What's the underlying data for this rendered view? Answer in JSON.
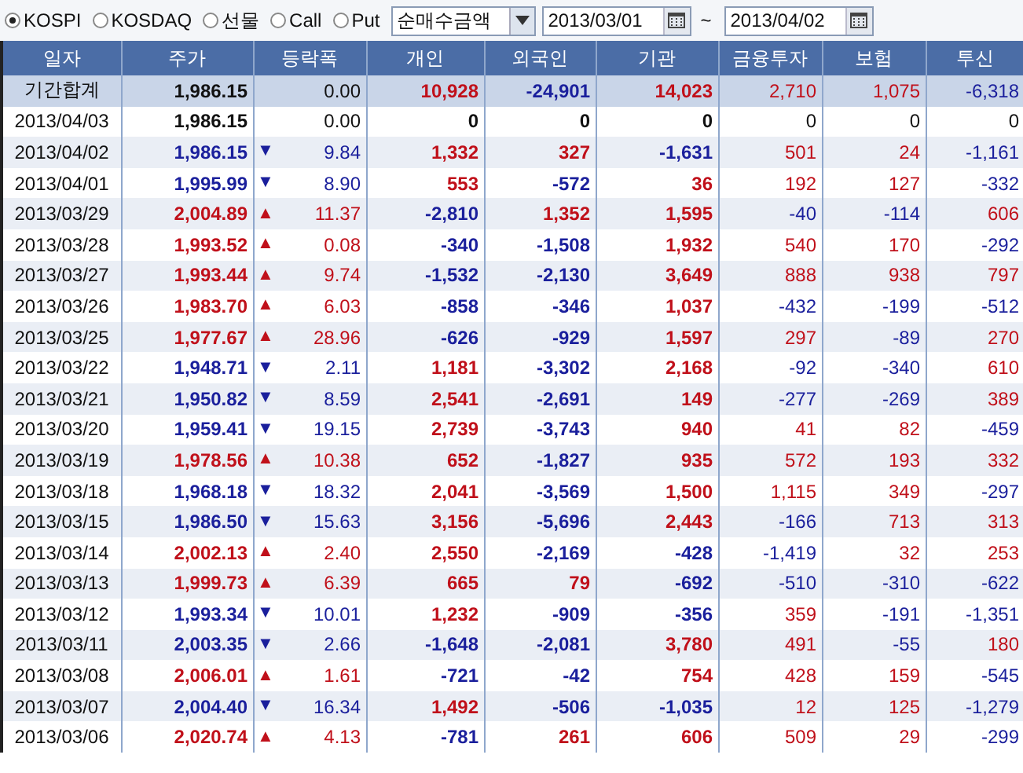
{
  "toolbar": {
    "markets": [
      {
        "label": "KOSPI",
        "selected": true
      },
      {
        "label": "KOSDAQ",
        "selected": false
      },
      {
        "label": "선물",
        "selected": false
      },
      {
        "label": "Call",
        "selected": false
      },
      {
        "label": "Put",
        "selected": false
      }
    ],
    "measure": "순매수금액",
    "date_from": "2013/03/01",
    "range_separator": "~",
    "date_to": "2013/04/02"
  },
  "table": {
    "columns": [
      "일자",
      "주가",
      "등락폭",
      "개인",
      "외국인",
      "기관",
      "금융투자",
      "보험",
      "투신"
    ],
    "rows": [
      {
        "kind": "total",
        "color": "#111111",
        "cells": [
          "기간합계",
          "1,986.15",
          "0.00",
          "10,928",
          "-24,901",
          "14,023",
          "2,710",
          "1,075",
          "-6,318"
        ]
      },
      {
        "kind": "day",
        "color": "#111111",
        "cells": [
          "2013/04/03",
          "1,986.15",
          "0.00",
          "0",
          "0",
          "0",
          "0",
          "0",
          "0"
        ]
      },
      {
        "kind": "day",
        "color": "#1a1f9c",
        "arrow": "▼",
        "cells": [
          "2013/04/02",
          "1,986.15",
          "9.84",
          "1,332",
          "327",
          "-1,631",
          "501",
          "24",
          "-1,161"
        ]
      },
      {
        "kind": "day",
        "color": "#1a1f9c",
        "arrow": "▼",
        "cells": [
          "2013/04/01",
          "1,995.99",
          "8.90",
          "553",
          "-572",
          "36",
          "192",
          "127",
          "-332"
        ]
      },
      {
        "kind": "day",
        "color": "#c0101a",
        "arrow": "▲",
        "cells": [
          "2013/03/29",
          "2,004.89",
          "11.37",
          "-2,810",
          "1,352",
          "1,595",
          "-40",
          "-114",
          "606"
        ]
      },
      {
        "kind": "day",
        "color": "#c0101a",
        "arrow": "▲",
        "cells": [
          "2013/03/28",
          "1,993.52",
          "0.08",
          "-340",
          "-1,508",
          "1,932",
          "540",
          "170",
          "-292"
        ]
      },
      {
        "kind": "day",
        "color": "#c0101a",
        "arrow": "▲",
        "cells": [
          "2013/03/27",
          "1,993.44",
          "9.74",
          "-1,532",
          "-2,130",
          "3,649",
          "888",
          "938",
          "797"
        ]
      },
      {
        "kind": "day",
        "color": "#c0101a",
        "arrow": "▲",
        "cells": [
          "2013/03/26",
          "1,983.70",
          "6.03",
          "-858",
          "-346",
          "1,037",
          "-432",
          "-199",
          "-512"
        ]
      },
      {
        "kind": "day",
        "color": "#c0101a",
        "arrow": "▲",
        "cells": [
          "2013/03/25",
          "1,977.67",
          "28.96",
          "-626",
          "-929",
          "1,597",
          "297",
          "-89",
          "270"
        ]
      },
      {
        "kind": "day",
        "color": "#1a1f9c",
        "arrow": "▼",
        "cells": [
          "2013/03/22",
          "1,948.71",
          "2.11",
          "1,181",
          "-3,302",
          "2,168",
          "-92",
          "-340",
          "610"
        ]
      },
      {
        "kind": "day",
        "color": "#1a1f9c",
        "arrow": "▼",
        "cells": [
          "2013/03/21",
          "1,950.82",
          "8.59",
          "2,541",
          "-2,691",
          "149",
          "-277",
          "-269",
          "389"
        ]
      },
      {
        "kind": "day",
        "color": "#1a1f9c",
        "arrow": "▼",
        "cells": [
          "2013/03/20",
          "1,959.41",
          "19.15",
          "2,739",
          "-3,743",
          "940",
          "41",
          "82",
          "-459"
        ]
      },
      {
        "kind": "day",
        "color": "#c0101a",
        "arrow": "▲",
        "cells": [
          "2013/03/19",
          "1,978.56",
          "10.38",
          "652",
          "-1,827",
          "935",
          "572",
          "193",
          "332"
        ]
      },
      {
        "kind": "day",
        "color": "#1a1f9c",
        "arrow": "▼",
        "cells": [
          "2013/03/18",
          "1,968.18",
          "18.32",
          "2,041",
          "-3,569",
          "1,500",
          "1,115",
          "349",
          "-297"
        ]
      },
      {
        "kind": "day",
        "color": "#1a1f9c",
        "arrow": "▼",
        "cells": [
          "2013/03/15",
          "1,986.50",
          "15.63",
          "3,156",
          "-5,696",
          "2,443",
          "-166",
          "713",
          "313"
        ]
      },
      {
        "kind": "day",
        "color": "#c0101a",
        "arrow": "▲",
        "cells": [
          "2013/03/14",
          "2,002.13",
          "2.40",
          "2,550",
          "-2,169",
          "-428",
          "-1,419",
          "32",
          "253"
        ]
      },
      {
        "kind": "day",
        "color": "#c0101a",
        "arrow": "▲",
        "cells": [
          "2013/03/13",
          "1,999.73",
          "6.39",
          "665",
          "79",
          "-692",
          "-510",
          "-310",
          "-622"
        ]
      },
      {
        "kind": "day",
        "color": "#1a1f9c",
        "arrow": "▼",
        "cells": [
          "2013/03/12",
          "1,993.34",
          "10.01",
          "1,232",
          "-909",
          "-356",
          "359",
          "-191",
          "-1,351"
        ]
      },
      {
        "kind": "day",
        "color": "#1a1f9c",
        "arrow": "▼",
        "cells": [
          "2013/03/11",
          "2,003.35",
          "2.66",
          "-1,648",
          "-2,081",
          "3,780",
          "491",
          "-55",
          "180"
        ]
      },
      {
        "kind": "day",
        "color": "#c0101a",
        "arrow": "▲",
        "cells": [
          "2013/03/08",
          "2,006.01",
          "1.61",
          "-721",
          "-42",
          "754",
          "428",
          "159",
          "-545"
        ]
      },
      {
        "kind": "day",
        "color": "#1a1f9c",
        "arrow": "▼",
        "cells": [
          "2013/03/07",
          "2,004.40",
          "16.34",
          "1,492",
          "-506",
          "-1,035",
          "12",
          "125",
          "-1,279"
        ]
      },
      {
        "kind": "day",
        "color": "#c0101a",
        "arrow": "▲",
        "cells": [
          "2013/03/06",
          "2,020.74",
          "4.13",
          "-781",
          "261",
          "606",
          "509",
          "29",
          "-299"
        ]
      }
    ]
  }
}
